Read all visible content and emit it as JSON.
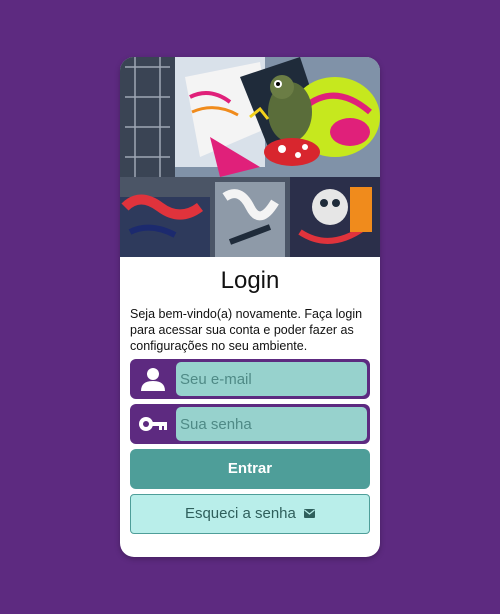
{
  "page": {
    "background_color": "#5d2a80"
  },
  "hero": {
    "alt": "graffiti-wall-illustration"
  },
  "login": {
    "title": "Login",
    "subtitle": "Seja bem-vindo(a) novamente. Faça login para acessar sua conta e poder fazer as configurações no seu ambiente."
  },
  "form": {
    "email": {
      "placeholder": "Seu e-mail",
      "value": "",
      "icon": "user-icon"
    },
    "password": {
      "placeholder": "Sua senha",
      "value": "",
      "icon": "key-icon"
    },
    "submit_label": "Entrar",
    "forgot_label": "Esqueci a senha",
    "forgot_icon": "mail-icon"
  },
  "colors": {
    "accent": "#5d2a80",
    "input_bg": "#97d2cd",
    "primary_button": "#4e9e99",
    "secondary_button": "#b9eeea"
  }
}
